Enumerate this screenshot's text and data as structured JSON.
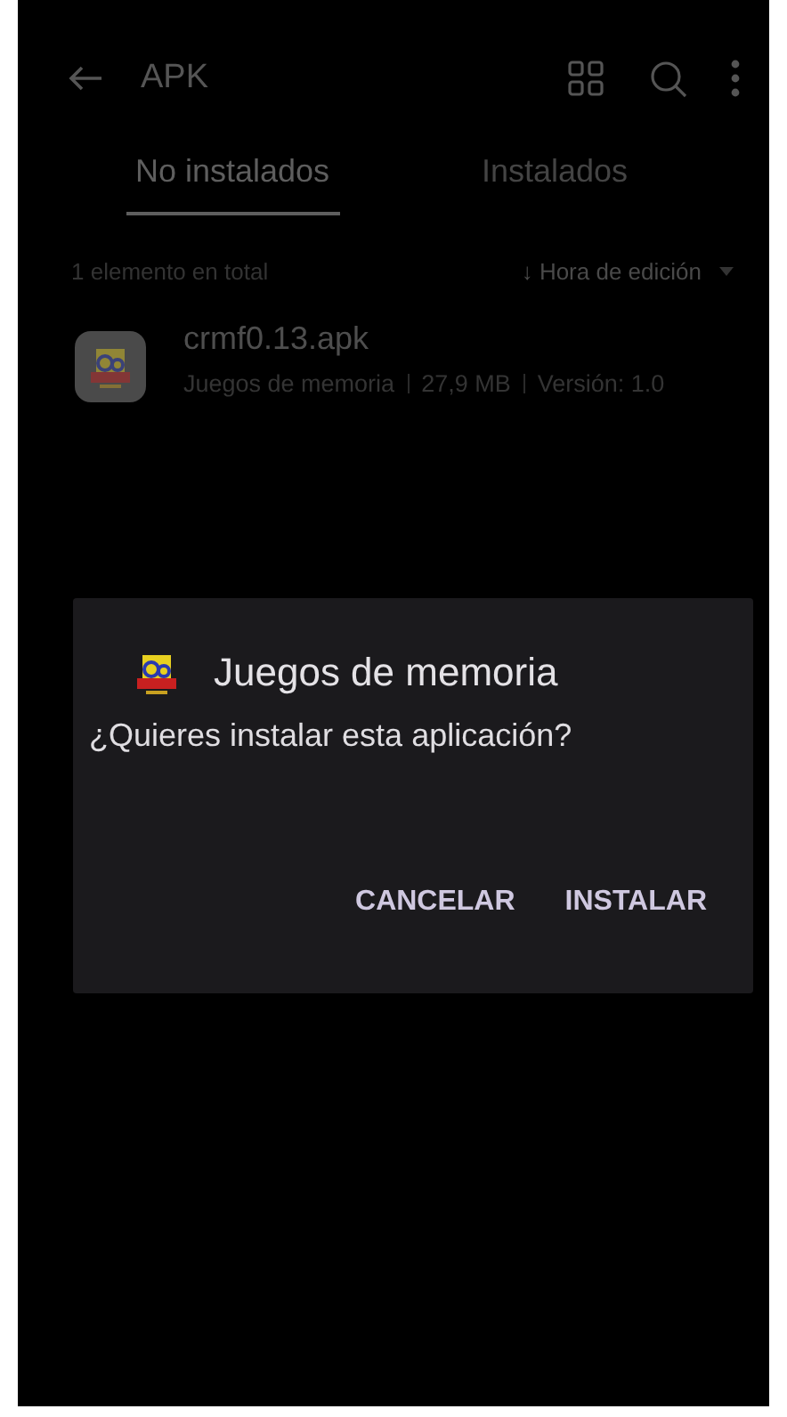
{
  "top_bar": {
    "title": "APK"
  },
  "tabs": [
    {
      "label": "No instalados",
      "selected": true
    },
    {
      "label": "Instalados",
      "selected": false
    }
  ],
  "list_header": {
    "count": "1 elemento en total",
    "sort": "↓ Hora de edición"
  },
  "files": [
    {
      "name": "crmf0.13.apk",
      "details": [
        "Juegos de memoria",
        "27,9 MB",
        "Versión: 1.0"
      ]
    }
  ],
  "dialog": {
    "title": "Juegos de memoria",
    "message": "¿Quieres instalar esta aplicación?",
    "buttons": [
      "CANCELAR",
      "INSTALAR"
    ]
  }
}
